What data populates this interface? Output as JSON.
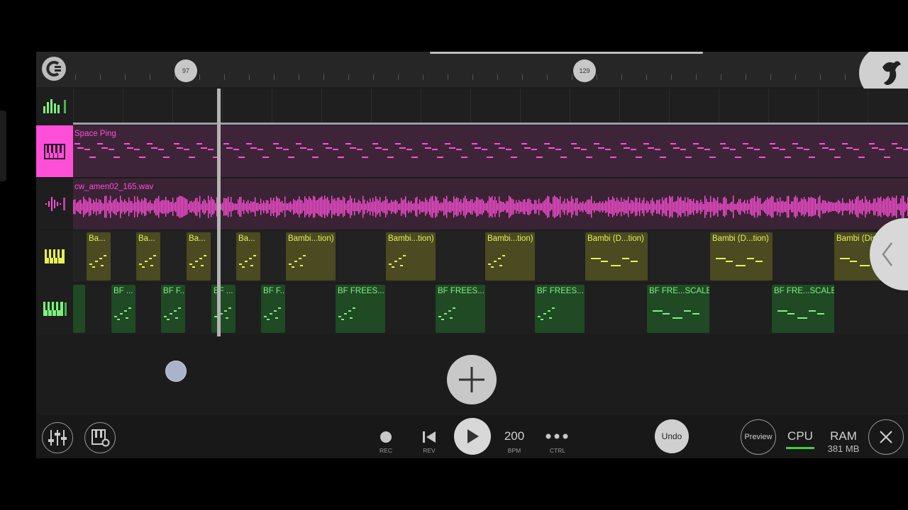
{
  "timeline": {
    "markers": [
      "97",
      "129"
    ]
  },
  "tracks": [
    {
      "name": "",
      "icon": "level-meter-icon"
    },
    {
      "name": "Space Ping",
      "icon": "piano-keys-icon",
      "color": "#ff4fd8"
    },
    {
      "name": "cw_amen02_165.wav",
      "icon": "waveform-icon",
      "color": "#ff4fd8"
    },
    {
      "name": "",
      "icon": "piano-keys-icon",
      "color": "#e6f05a"
    },
    {
      "name": "",
      "icon": "piano-keys-icon",
      "color": "#7ef07e"
    }
  ],
  "clips_yellow": [
    "Ba...",
    "Ba...",
    "Ba...",
    "Ba...",
    "Bambi...tion)",
    "Bambi...tion)",
    "Bambi...tion)",
    "Bambi (D...tion)",
    "Bambi (D...tion)",
    "Bambi (Dis"
  ],
  "clips_green": [
    "BF ...",
    "BF F...",
    "BF ...",
    "BF F...",
    "BF FREES...",
    "BF FREES...",
    "BF FREES...",
    "BF FRE...SCALE",
    "BF FRE...SCALE"
  ],
  "transport": {
    "rec": "REC",
    "rev": "REV",
    "bpm_value": "200",
    "bpm_label": "BPM",
    "ctrl": "CTRL",
    "undo": "Undo",
    "preview": "Preview",
    "cpu": "CPU",
    "ram": "RAM",
    "ram_value": "381 MB"
  },
  "colors": {
    "accent_pink": "#ff4fd8",
    "clip_yellow": "#e6f05a",
    "clip_green": "#7ef07e",
    "cpu_bar": "#3cd23c"
  }
}
